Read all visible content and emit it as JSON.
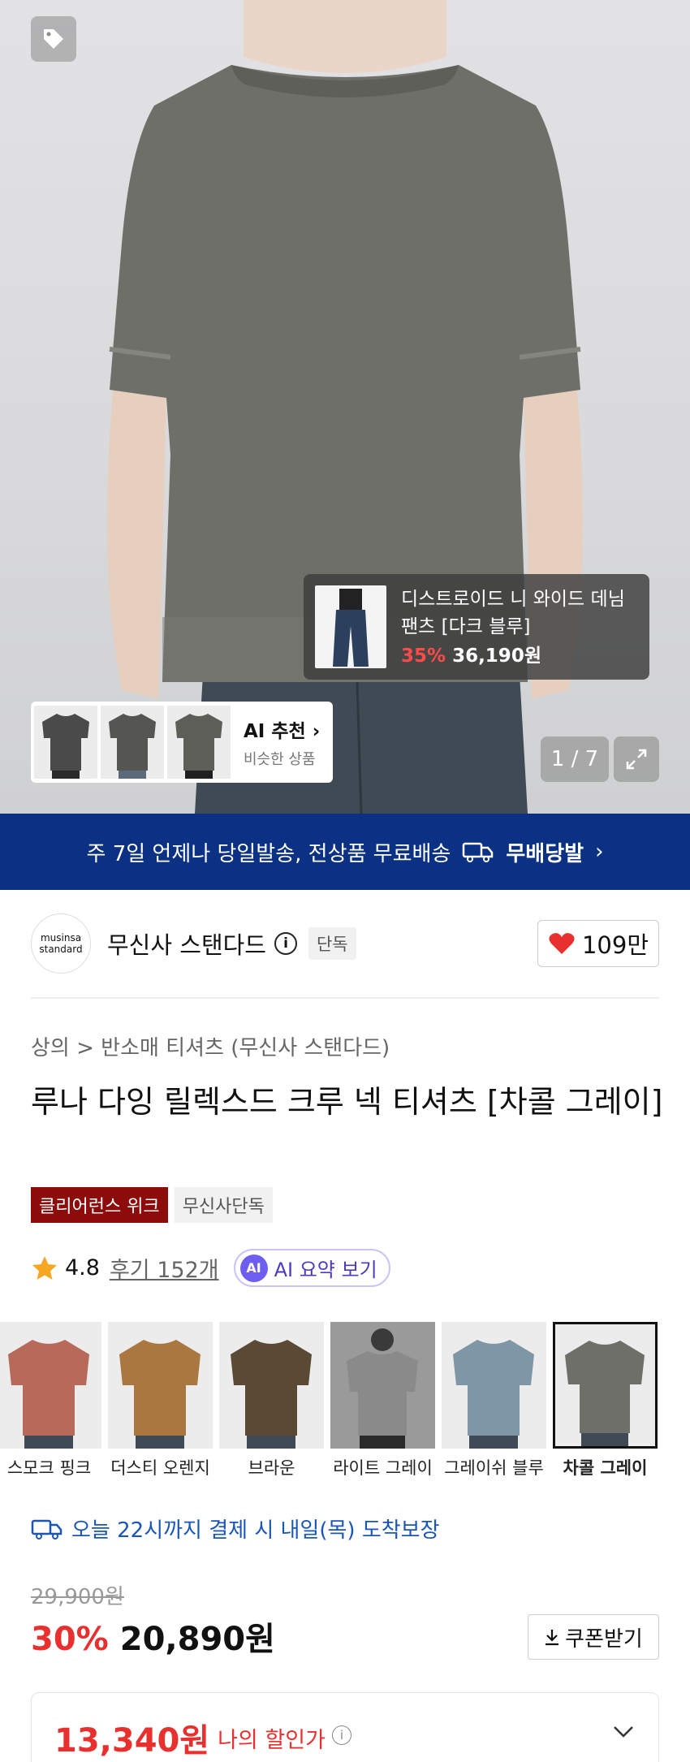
{
  "gallery": {
    "counter": "1 / 7",
    "similar": {
      "title": "AI 추천",
      "subtitle": "비슷한 상품"
    },
    "tagged_item": {
      "name": "디스트로이드 니 와이드 데님 팬츠 [다크 블루]",
      "discount": "35%",
      "price": "36,190원"
    }
  },
  "banner": {
    "text": "주 7일 언제나 당일발송, 전상품 무료배송",
    "brand": "무배당발"
  },
  "brand": {
    "logo_text": "musinsa standard",
    "name": "무신사 스탠다드",
    "exclusive": "단독",
    "likes": "109만"
  },
  "product": {
    "breadcrumb": "상의 > 반소매 티셔츠 (무신사 스탠다드)",
    "title": "루나 다잉 릴렉스드 크루 넥 티셔츠 [차콜 그레이]",
    "badges": [
      "클리어런스 위크",
      "무신사단독"
    ],
    "rating": "4.8",
    "review": "후기 152개",
    "ai_summary": "AI 요약 보기",
    "ai_badge": "AI"
  },
  "colors": [
    {
      "label": "스모크 핑크",
      "color": "#b86a5a"
    },
    {
      "label": "더스티 오렌지",
      "color": "#a9773f"
    },
    {
      "label": "브라운",
      "color": "#5a4a35"
    },
    {
      "label": "라이트 그레이",
      "color": "#8a8a8a"
    },
    {
      "label": "그레이쉬 블루",
      "color": "#7f96a6"
    },
    {
      "label": "차콜 그레이",
      "color": "#6f6f69"
    }
  ],
  "delivery": "오늘 22시까지 결제 시 내일(목) 도착보장",
  "price": {
    "original": "29,900원",
    "discount": "30%",
    "sale": "20,890원",
    "coupon": "쿠폰받기",
    "my_price": "13,340원",
    "my_label": "나의 할인가"
  },
  "accent": "#0a3184"
}
